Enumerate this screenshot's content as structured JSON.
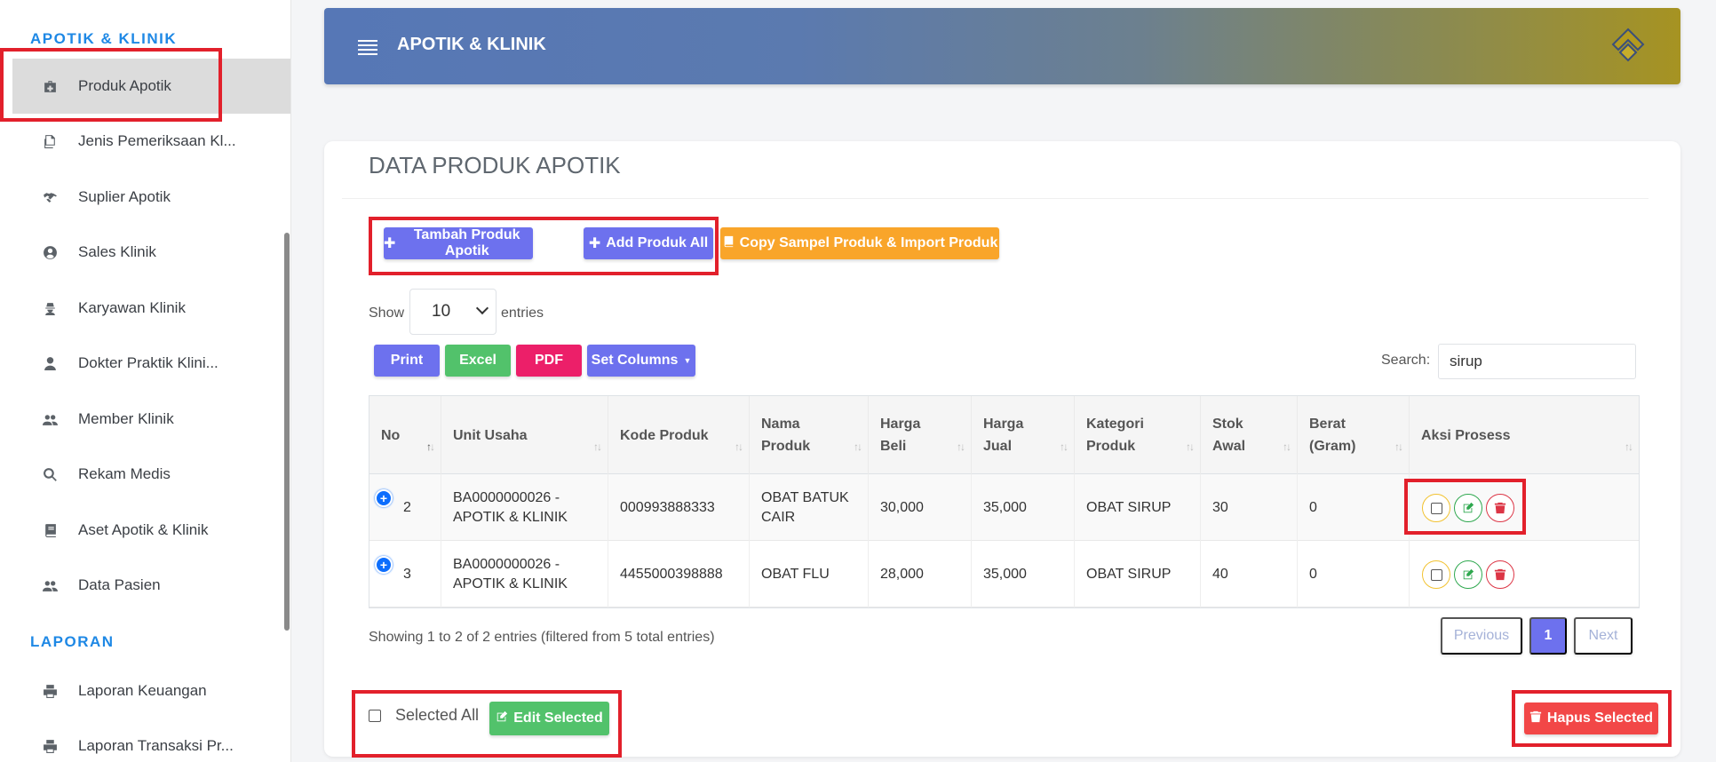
{
  "sidebar": {
    "section_apotik": "APOTIK & KLINIK",
    "section_laporan": "LAPORAN",
    "items": [
      {
        "label": "Produk Apotik",
        "icon": "medkit-icon"
      },
      {
        "label": "Jenis Pemeriksaan Kl...",
        "icon": "copy-icon"
      },
      {
        "label": "Suplier Apotik",
        "icon": "handshake-icon"
      },
      {
        "label": "Sales Klinik",
        "icon": "user-circle-icon"
      },
      {
        "label": "Karyawan Klinik",
        "icon": "user-secret-icon"
      },
      {
        "label": "Dokter Praktik Klini...",
        "icon": "user-icon"
      },
      {
        "label": "Member Klinik",
        "icon": "users-icon"
      },
      {
        "label": "Rekam Medis",
        "icon": "search-icon"
      },
      {
        "label": "Aset Apotik & Klinik",
        "icon": "book-icon"
      },
      {
        "label": "Data Pasien",
        "icon": "users-icon"
      }
    ],
    "laporan_items": [
      {
        "label": "Laporan Keuangan",
        "icon": "print-icon"
      },
      {
        "label": "Laporan Transaksi Pr...",
        "icon": "print-icon"
      }
    ]
  },
  "header": {
    "title": "APOTIK & KLINIK"
  },
  "card": {
    "title": "DATA PRODUK APOTIK",
    "btn_tambah": "Tambah Produk Apotik",
    "btn_add_all": "Add Produk All",
    "btn_copy": "Copy Sampel Produk & Import Produk",
    "show_label": "Show",
    "entries_value": "10",
    "entries_label": "entries",
    "btn_print": "Print",
    "btn_excel": "Excel",
    "btn_pdf": "PDF",
    "btn_set_columns": "Set Columns",
    "search_label": "Search:",
    "search_value": "sirup"
  },
  "table": {
    "headers": [
      {
        "l1": "No",
        "l2": ""
      },
      {
        "l1": "Unit Usaha",
        "l2": ""
      },
      {
        "l1": "Kode Produk",
        "l2": ""
      },
      {
        "l1": "Nama",
        "l2": "Produk"
      },
      {
        "l1": "Harga",
        "l2": "Beli"
      },
      {
        "l1": "Harga",
        "l2": "Jual"
      },
      {
        "l1": "Kategori",
        "l2": "Produk"
      },
      {
        "l1": "Stok",
        "l2": "Awal"
      },
      {
        "l1": "Berat",
        "l2": "(Gram)"
      },
      {
        "l1": "Aksi Prosess",
        "l2": ""
      }
    ],
    "rows": [
      {
        "no": "2",
        "unit_l1": "BA0000000026 -",
        "unit_l2": "APOTIK & KLINIK",
        "kode": "000993888333",
        "nama_l1": "OBAT BATUK",
        "nama_l2": "CAIR",
        "beli": "30,000",
        "jual": "35,000",
        "kategori": "OBAT SIRUP",
        "stok": "30",
        "berat": "0"
      },
      {
        "no": "3",
        "unit_l1": "BA0000000026 -",
        "unit_l2": "APOTIK & KLINIK",
        "kode": "4455000398888",
        "nama_l1": "OBAT FLU",
        "nama_l2": "",
        "beli": "28,000",
        "jual": "35,000",
        "kategori": "OBAT SIRUP",
        "stok": "40",
        "berat": "0"
      }
    ]
  },
  "footer": {
    "info": "Showing 1 to 2 of 2 entries (filtered from 5 total entries)",
    "prev": "Previous",
    "page": "1",
    "next": "Next",
    "selected_all": "Selected All",
    "btn_edit_selected": "Edit Selected",
    "btn_hapus_selected": "Hapus Selected"
  },
  "colors": {
    "accent": "#6d71ee",
    "section_label": "#1e88e5",
    "highlight_box": "#e2202b"
  }
}
